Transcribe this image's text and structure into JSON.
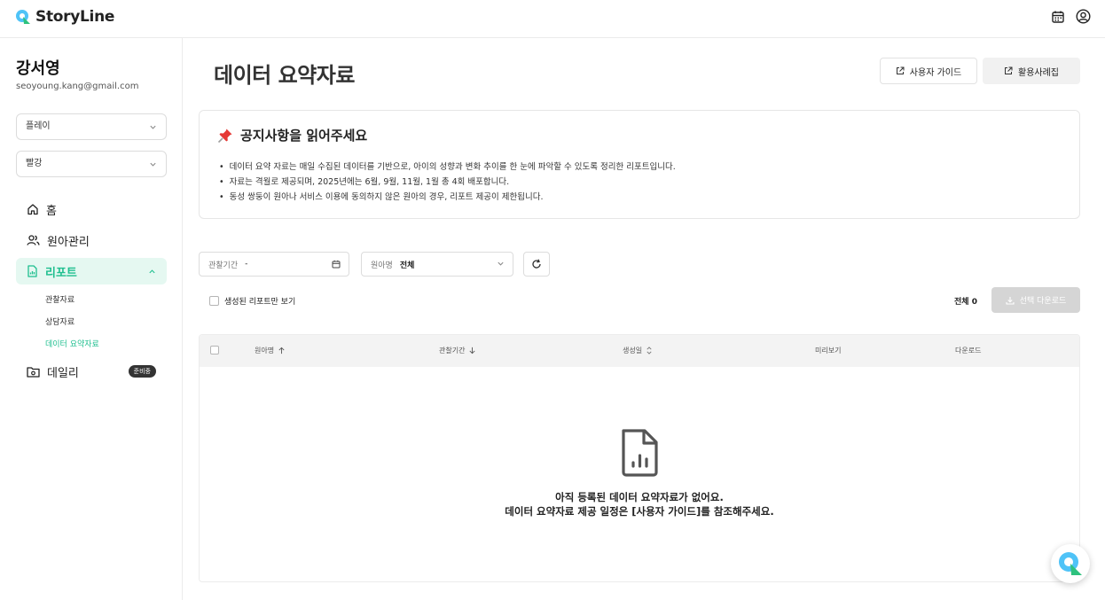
{
  "app": {
    "name": "StoryLine"
  },
  "header": {
    "icons": [
      "calendar-icon",
      "user-circle-icon"
    ]
  },
  "sidebar": {
    "user_name": "강서영",
    "user_email": "seoyoung.kang@gmail.com",
    "selects": [
      {
        "value": "플레이"
      },
      {
        "value": "빨강"
      }
    ],
    "nav": {
      "home": "홈",
      "children": "원아관리",
      "report": "리포트",
      "daily": "데일리",
      "daily_badge": "준비중"
    },
    "report_sub": [
      "관찰자료",
      "상담자료",
      "데이터 요약자료"
    ]
  },
  "main": {
    "title": "데이터 요약자료",
    "buttons": {
      "user_guide": "사용자 가이드",
      "use_cases": "활용사례집"
    },
    "notice": {
      "title": "공지사항을 읽어주세요",
      "items": [
        "데이터 요약 자료는 매일 수집된 데이터를 기반으로, 아이의 성향과 변화 추이를 한 눈에 파악할 수 있도록 정리한 리포트입니다.",
        "자료는 격월로 제공되며, 2025년에는 6월, 9월, 11월, 1월 총 4회 배포합니다.",
        "동성 쌍둥이 원아나 서비스 이용에 동의하지 않은 원아의 경우, 리포트 제공이 제한됩니다."
      ]
    },
    "filters": {
      "period_label": "관찰기간",
      "period_value": "-",
      "name_label": "원아명",
      "name_value": "전체"
    },
    "only_generated_label": "생성된 리포트만 보기",
    "total_label": "전체 0",
    "download_label": "선택 다운로드",
    "table": {
      "columns": [
        "원아명",
        "관찰기간",
        "생성일",
        "미리보기",
        "다운로드"
      ],
      "empty_line1": "아직 등록된 데이터 요약자료가 없어요.",
      "empty_line2": "데이터 요약자료 제공 일정은 [사용자 가이드]를 참조해주세요."
    }
  },
  "colors": {
    "accent": "#1fbf8f",
    "accent_bg": "#e5f8f1"
  }
}
